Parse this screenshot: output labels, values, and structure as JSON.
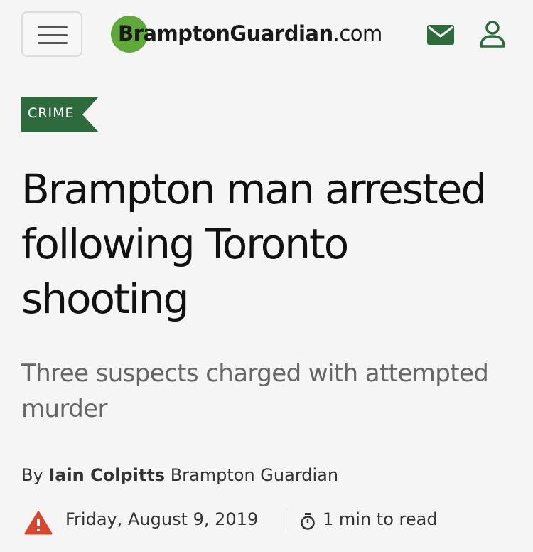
{
  "header": {
    "menu_icon": "hamburger-menu-icon",
    "logo": {
      "brand": "BramptonGuardian",
      "tld": ".com"
    },
    "mail_icon": "envelope-icon",
    "account_icon": "user-icon",
    "brand_color": "#5fa83a",
    "icon_color": "#2d6b3c"
  },
  "article": {
    "section": "CRIME",
    "section_color": "#2d6b3c",
    "headline": "Brampton man arrested following Toronto shooting",
    "subheadline": "Three suspects charged with attempted murder",
    "byline": {
      "prefix": "By",
      "author": "Iain Colpitts",
      "outlet": "Brampton Guardian"
    },
    "meta": {
      "alert_icon": "warning-triangle-icon",
      "alert_color": "#d9472b",
      "date": "Friday, August 9, 2019",
      "timer_icon": "stopwatch-icon",
      "read_time": "1 min to read"
    }
  }
}
